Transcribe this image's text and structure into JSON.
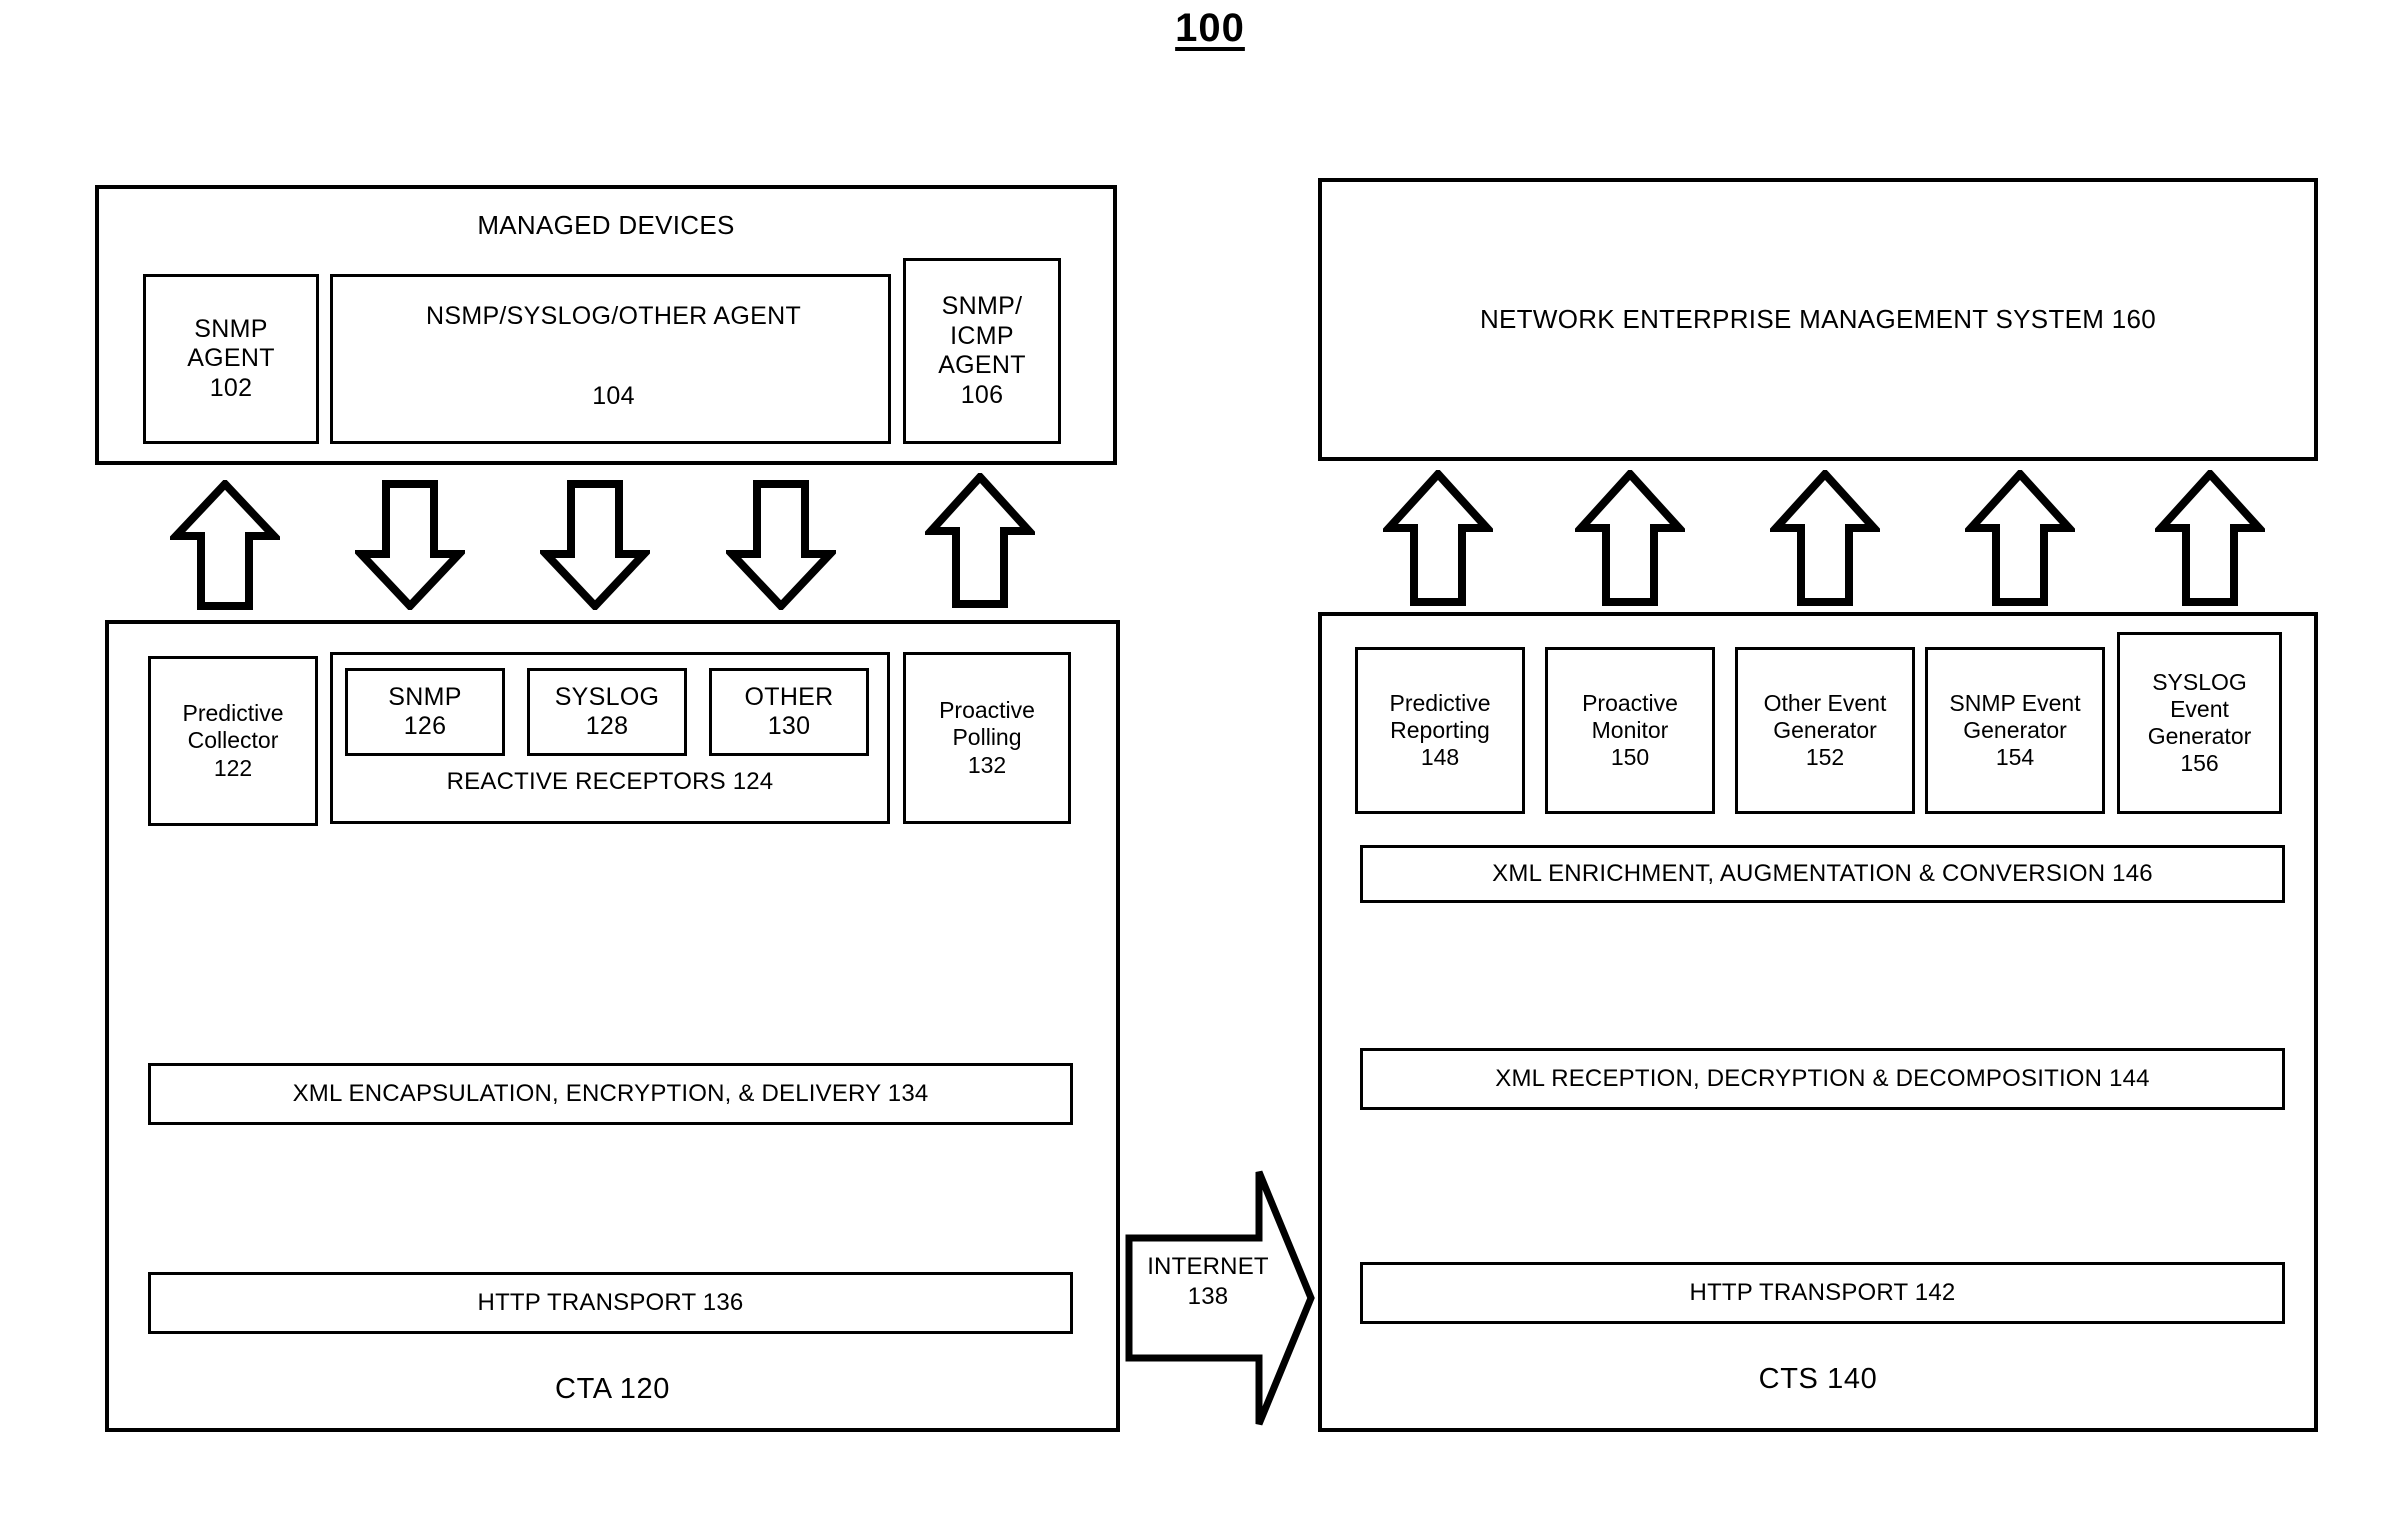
{
  "figure": {
    "number": "100"
  },
  "managed_devices": {
    "title": "MANAGED DEVICES",
    "agents": [
      {
        "name": "snmp-agent",
        "lines": [
          "SNMP",
          "AGENT",
          "102"
        ]
      },
      {
        "name": "nsmp-syslog-other-agent",
        "lines": [
          "NSMP/SYSLOG/OTHER AGENT",
          "",
          "104"
        ]
      },
      {
        "name": "snmp-icmp-agent",
        "lines": [
          "SNMP/",
          "ICMP",
          "AGENT",
          "106"
        ]
      }
    ]
  },
  "nems": {
    "title": "NETWORK ENTERPRISE MANAGEMENT SYSTEM  160"
  },
  "cta": {
    "footer": "CTA  120",
    "predictive_collector": {
      "l1": "Predictive",
      "l2": "Collector",
      "l3": "122"
    },
    "reactive_receptors": {
      "label": "REACTIVE RECEPTORS   124",
      "items": [
        {
          "name": "snmp",
          "l1": "SNMP",
          "l2": "126"
        },
        {
          "name": "syslog",
          "l1": "SYSLOG",
          "l2": "128"
        },
        {
          "name": "other",
          "l1": "OTHER",
          "l2": "130"
        }
      ]
    },
    "proactive_polling": {
      "l1": "Proactive",
      "l2": "Polling",
      "l3": "132"
    },
    "xml_encapsulation": "XML ENCAPSULATION, ENCRYPTION, & DELIVERY  134",
    "http_transport": "HTTP TRANSPORT  136"
  },
  "internet": {
    "l1": "INTERNET",
    "l2": "138"
  },
  "cts": {
    "footer": "CTS  140",
    "modules": [
      {
        "name": "predictive-reporting",
        "l1": "Predictive",
        "l2": "Reporting",
        "l3": "148"
      },
      {
        "name": "proactive-monitor",
        "l1": "Proactive",
        "l2": "Monitor",
        "l3": "150"
      },
      {
        "name": "other-event-generator",
        "l1": "Other Event",
        "l2": "Generator",
        "l3": "152"
      },
      {
        "name": "snmp-event-generator",
        "l1": "SNMP Event",
        "l2": "Generator",
        "l3": "154"
      },
      {
        "name": "syslog-event-generator",
        "l1": "SYSLOG",
        "l2": "Event",
        "l3": "Generator",
        "l4": "156"
      }
    ],
    "xml_enrichment": "XML ENRICHMENT, AUGMENTATION & CONVERSION  146",
    "xml_reception": "XML RECEPTION, DECRYPTION & DECOMPOSITION  144",
    "http_transport": "HTTP TRANSPORT  142"
  },
  "colors": {
    "ink": "#000000",
    "paper": "#ffffff"
  }
}
